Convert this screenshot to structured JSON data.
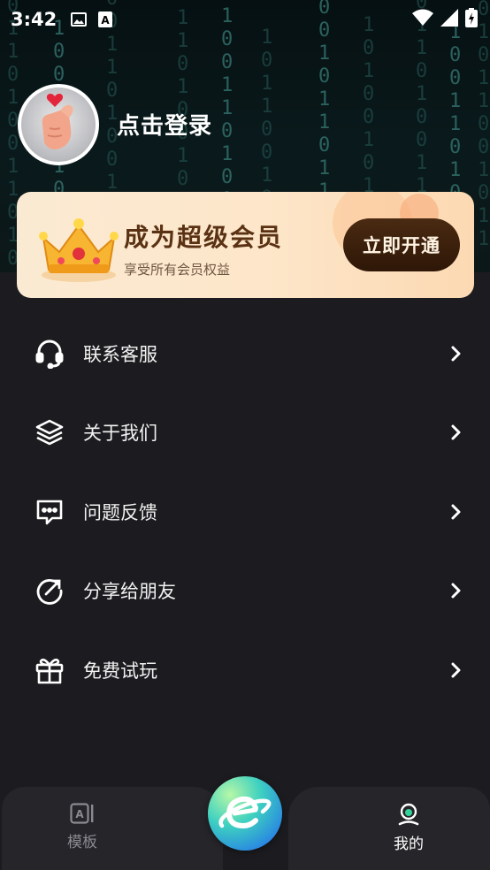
{
  "status_bar": {
    "time": "3:42",
    "icons": [
      "image-notification-icon",
      "a-notification-icon",
      "wifi-icon",
      "cellular-icon",
      "battery-icon"
    ]
  },
  "profile": {
    "login_text": "点击登录"
  },
  "vip_banner": {
    "title": "成为超级会员",
    "subtitle": "享受所有会员权益",
    "button_label": "立即开通"
  },
  "menu": {
    "items": [
      {
        "label": "联系客服",
        "icon": "headset-icon"
      },
      {
        "label": "关于我们",
        "icon": "layers-icon"
      },
      {
        "label": "问题反馈",
        "icon": "feedback-icon"
      },
      {
        "label": "分享给朋友",
        "icon": "share-icon"
      },
      {
        "label": "免费试玩",
        "icon": "gift-icon"
      }
    ]
  },
  "bottom_nav": {
    "tabs": [
      {
        "label": "模板",
        "icon": "template-icon",
        "active": false
      },
      {
        "label": "我的",
        "icon": "profile-icon",
        "active": true
      }
    ],
    "center_icon": "planet-icon"
  },
  "colors": {
    "background": "#1c1c20",
    "vip_title": "#5a3213",
    "vip_button": "#3a1f0c",
    "accent_gradient_start": "#b6f7a7",
    "accent_gradient_end": "#2a5fd8"
  }
}
